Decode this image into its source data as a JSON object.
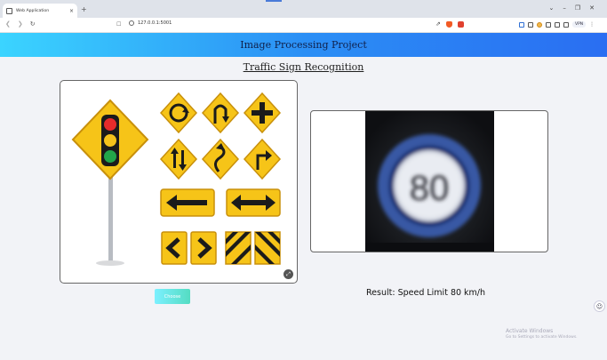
{
  "browser": {
    "tab_title": "Web Application",
    "tab_close": "×",
    "new_tab": "+",
    "url": "127.0.0.1:5001",
    "window_controls": [
      "⌄",
      "–",
      "❐",
      "✕"
    ],
    "vpn_label": "VPN",
    "nav_icons": [
      "back-arrow-icon",
      "forward-arrow-icon",
      "reload-icon"
    ]
  },
  "header": {
    "title": "Image Processing Project"
  },
  "page": {
    "subtitle": "Traffic Sign Recognition"
  },
  "uploaded_image": {
    "description_icon": "traffic-signs-collection",
    "expand_icon": "expand-icon"
  },
  "predicted_image": {
    "sign_value": "80"
  },
  "controls": {
    "choose_label": "Choose"
  },
  "result": {
    "text": "Result: Speed Limit 80 km/h"
  },
  "watermark": {
    "title": "Activate Windows",
    "subtitle": "Go to Settings to activate Windows."
  },
  "colors": {
    "banner_start": "#3bd4ff",
    "banner_end": "#2a6ef2",
    "sign_yellow": "#f6c418",
    "button_start": "#7cf0ff",
    "button_end": "#54dcc2"
  }
}
